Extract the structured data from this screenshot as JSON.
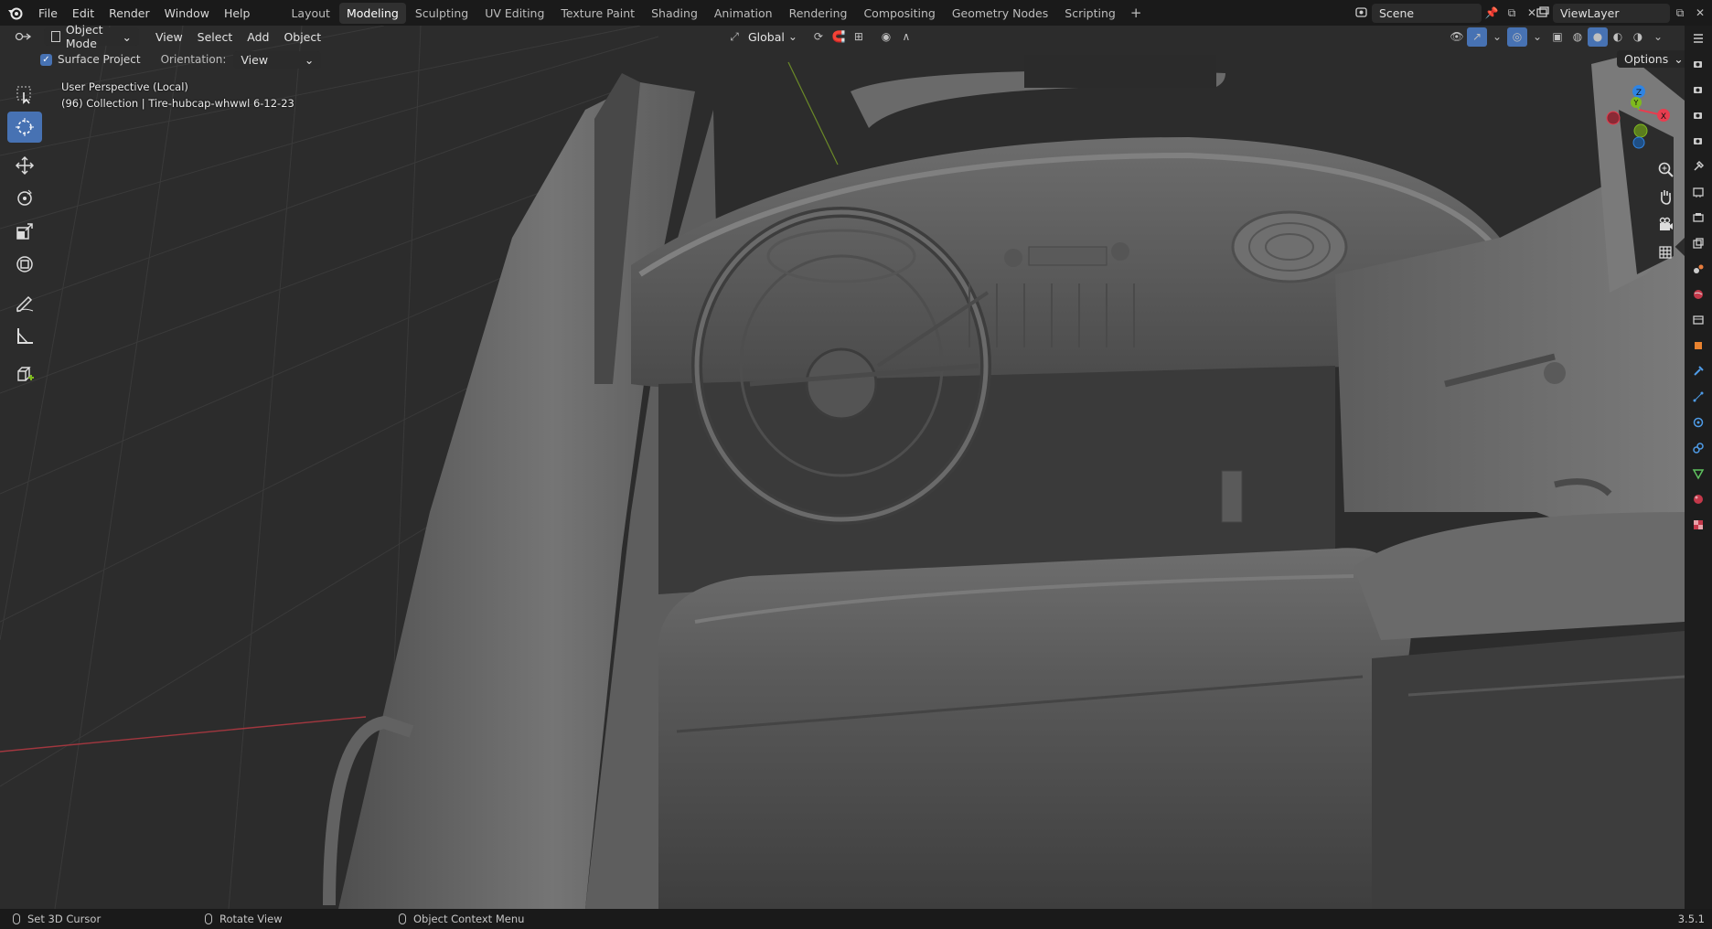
{
  "topbar": {
    "menu": [
      "File",
      "Edit",
      "Render",
      "Window",
      "Help"
    ],
    "workspaces": [
      "Layout",
      "Modeling",
      "Sculpting",
      "UV Editing",
      "Texture Paint",
      "Shading",
      "Animation",
      "Rendering",
      "Compositing",
      "Geometry Nodes",
      "Scripting"
    ],
    "active_workspace": "Modeling",
    "scene": "Scene",
    "view_layer": "ViewLayer"
  },
  "viewport_header": {
    "mode": "Object Mode",
    "menus": [
      "View",
      "Select",
      "Add",
      "Object"
    ],
    "transform_orientation": "Global"
  },
  "tool_options": {
    "surface_project_label": "Surface Project",
    "surface_project_checked": true,
    "orientation_label": "Orientation:",
    "orientation_value": "View",
    "options_label": "Options"
  },
  "viewport_info": {
    "perspective": "User Perspective (Local)",
    "collection": "(96) Collection | Tire-hubcap-whwwl  6-12-23"
  },
  "gizmo": {
    "z": "Z",
    "x": "X",
    "y": "Y"
  },
  "statusbar": {
    "left": "Set 3D Cursor",
    "middle": "Rotate View",
    "right": "Object Context Menu",
    "version": "3.5.1"
  },
  "colors": {
    "accent": "#4772b3",
    "x_axis": "#e83d4f",
    "y_axis": "#7fba1e",
    "z_axis": "#2f84e3"
  }
}
